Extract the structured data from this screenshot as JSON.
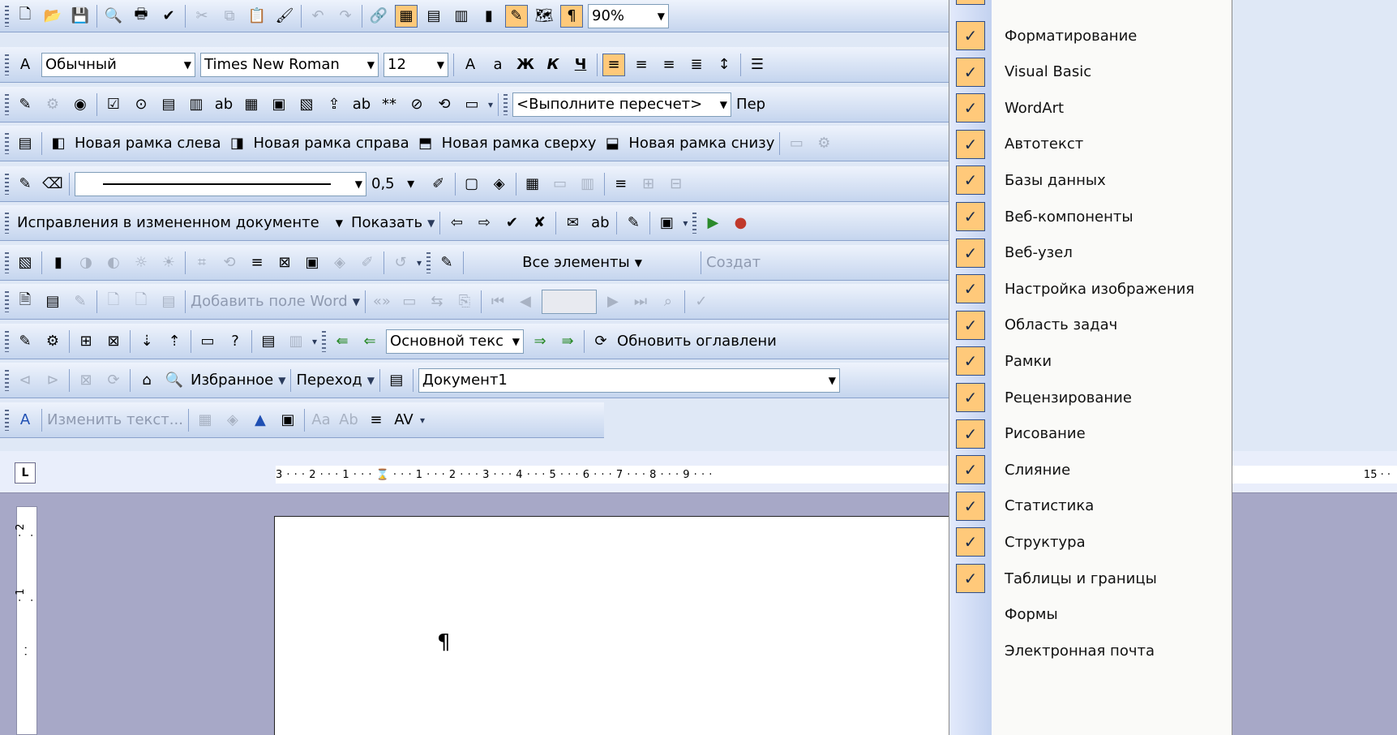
{
  "standard_toolbar": {
    "zoom_value": "90%"
  },
  "formatting_toolbar": {
    "style": "Обычный",
    "font": "Times New Roman",
    "size": "12"
  },
  "forms_toolbar": {
    "field_placeholder": "<Выполните пересчет>",
    "truncated_label": "Пер"
  },
  "frames_toolbar": {
    "new_frame_left": "Новая рамка слева",
    "new_frame_right": "Новая рамка справа",
    "new_frame_top": "Новая рамка сверху",
    "new_frame_bottom": "Новая рамка снизу"
  },
  "tables_toolbar": {
    "line_weight": "0,5"
  },
  "reviewing_toolbar": {
    "display_mode": "Исправления в измененном документе",
    "show_label": "Показать"
  },
  "outline_toolbar": {
    "show_level": "Все элементы",
    "create_label": "Создат"
  },
  "mail_merge_toolbar": {
    "insert_word_field": "Добавить поле Word"
  },
  "outlining2_toolbar": {
    "style_box": "Основной текс",
    "update_toc": "Обновить оглавлени"
  },
  "web_toolbar": {
    "favorites": "Избранное",
    "go": "Переход",
    "address": "Документ1"
  },
  "wordart_toolbar": {
    "edit_text": "Изменить текст..."
  },
  "ruler": {
    "marks": "3 · · · 2 · · · 1 · · · ⌛ · · · 1 · · · 2 · · · 3 · · · 4 · · · 5 · · · 6 · · · 7 · · · 8 · · · 9 · · ·",
    "right_mark": "15 · ·"
  },
  "document": {
    "pilcrow": "¶"
  },
  "toolbar_menu": {
    "items": [
      {
        "label": "Форматирование",
        "checked": true
      },
      {
        "label": "Visual Basic",
        "checked": true
      },
      {
        "label": "WordArt",
        "checked": true
      },
      {
        "label": "Автотекст",
        "checked": true
      },
      {
        "label": "Базы данных",
        "checked": true
      },
      {
        "label": "Веб-компоненты",
        "checked": true
      },
      {
        "label": "Веб-узел",
        "checked": true
      },
      {
        "label": "Настройка изображения",
        "checked": true
      },
      {
        "label": "Область задач",
        "checked": true
      },
      {
        "label": "Рамки",
        "checked": true
      },
      {
        "label": "Рецензирование",
        "checked": true
      },
      {
        "label": "Рисование",
        "checked": true
      },
      {
        "label": "Слияние",
        "checked": true
      },
      {
        "label": "Статистика",
        "checked": true
      },
      {
        "label": "Структура",
        "checked": true
      },
      {
        "label": "Таблицы и границы",
        "checked": true
      },
      {
        "label": "Формы",
        "checked": false
      },
      {
        "label": "Электронная почта",
        "checked": false
      }
    ],
    "check_glyph": "✓"
  },
  "colors": {
    "menu_check_bg": "#ffc97a",
    "toolbar_bg": "#c5d5ee",
    "workspace": "#a7a8c7"
  }
}
